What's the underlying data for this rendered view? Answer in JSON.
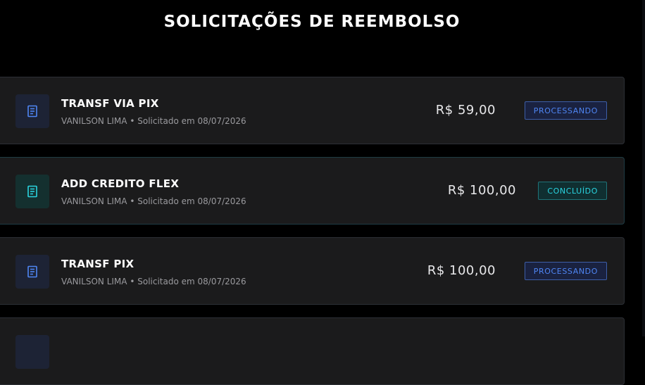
{
  "page": {
    "title": "SOLICITAÇÕES DE REEMBOLSO"
  },
  "requests": [
    {
      "title": "TRANSF VIA PIX",
      "requester": "VANILSON LIMA",
      "separator": "•",
      "requested_on": "Solicitado em 08/07/2026",
      "amount": "R$ 59,00",
      "status": "PROCESSANDO",
      "status_color": "#4f86f4",
      "icon": "receipt-icon"
    },
    {
      "title": "ADD CREDITO FLEX",
      "requester": "VANILSON LIMA",
      "separator": "•",
      "requested_on": "Solicitado em 08/07/2026",
      "amount": "R$ 100,00",
      "status": "CONCLUÍDO",
      "status_color": "#2ad4e0",
      "icon": "receipt-icon"
    },
    {
      "title": "TRANSF PIX",
      "requester": "VANILSON LIMA",
      "separator": "•",
      "requested_on": "Solicitado em 08/07/2026",
      "amount": "R$ 100,00",
      "status": "PROCESSANDO",
      "status_color": "#4f86f4",
      "icon": "receipt-icon"
    }
  ],
  "colors": {
    "background": "#000000",
    "card": "#1b1b1c",
    "processing": "#4f86f4",
    "completed": "#2ad4e0"
  }
}
